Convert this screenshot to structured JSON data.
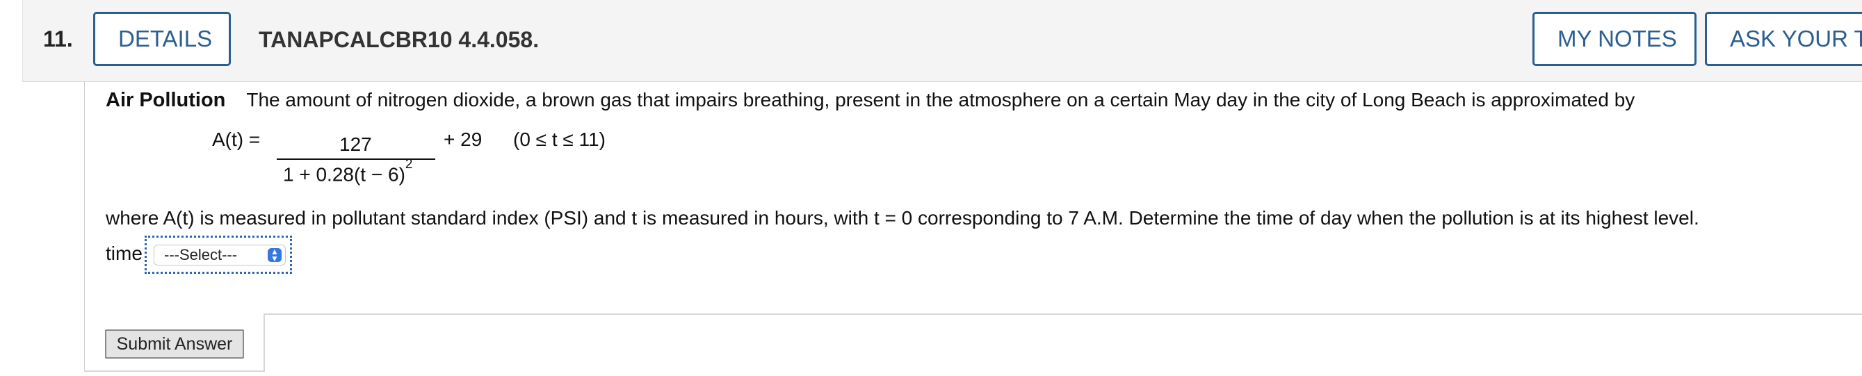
{
  "question": {
    "number": "11.",
    "details_label": "DETAILS",
    "problem_code": "TANAPCALCBR10 4.4.058.",
    "my_notes_label": "MY NOTES",
    "ask_label": "ASK YOUR TEACHER"
  },
  "body": {
    "title": "Air Pollution",
    "intro": "The amount of nitrogen dioxide, a brown gas that impairs breathing, present in the atmosphere on a certain May day in the city of Long Beach is approximated by",
    "formula_lhs": "A(t) =",
    "numerator": "127",
    "denominator": "1 + 0.28(t − 6)",
    "exponent": "2",
    "plus_term": "+ 29",
    "domain": "(0 ≤ t ≤ 11)",
    "where_text": "where A(t) is measured in pollutant standard index (PSI) and t is measured in hours, with t = 0 corresponding to 7 A.M. Determine the time of day when the pollution is at its highest level."
  },
  "answer": {
    "time_label": "time",
    "select_value": "---Select---",
    "select_icon": "updown-chevron-icon"
  },
  "actions": {
    "submit_label": "Submit Answer"
  },
  "colors": {
    "accent": "#2c5f8f",
    "focus_outline": "#2a66b5",
    "select_arrow": "#3578e5"
  }
}
